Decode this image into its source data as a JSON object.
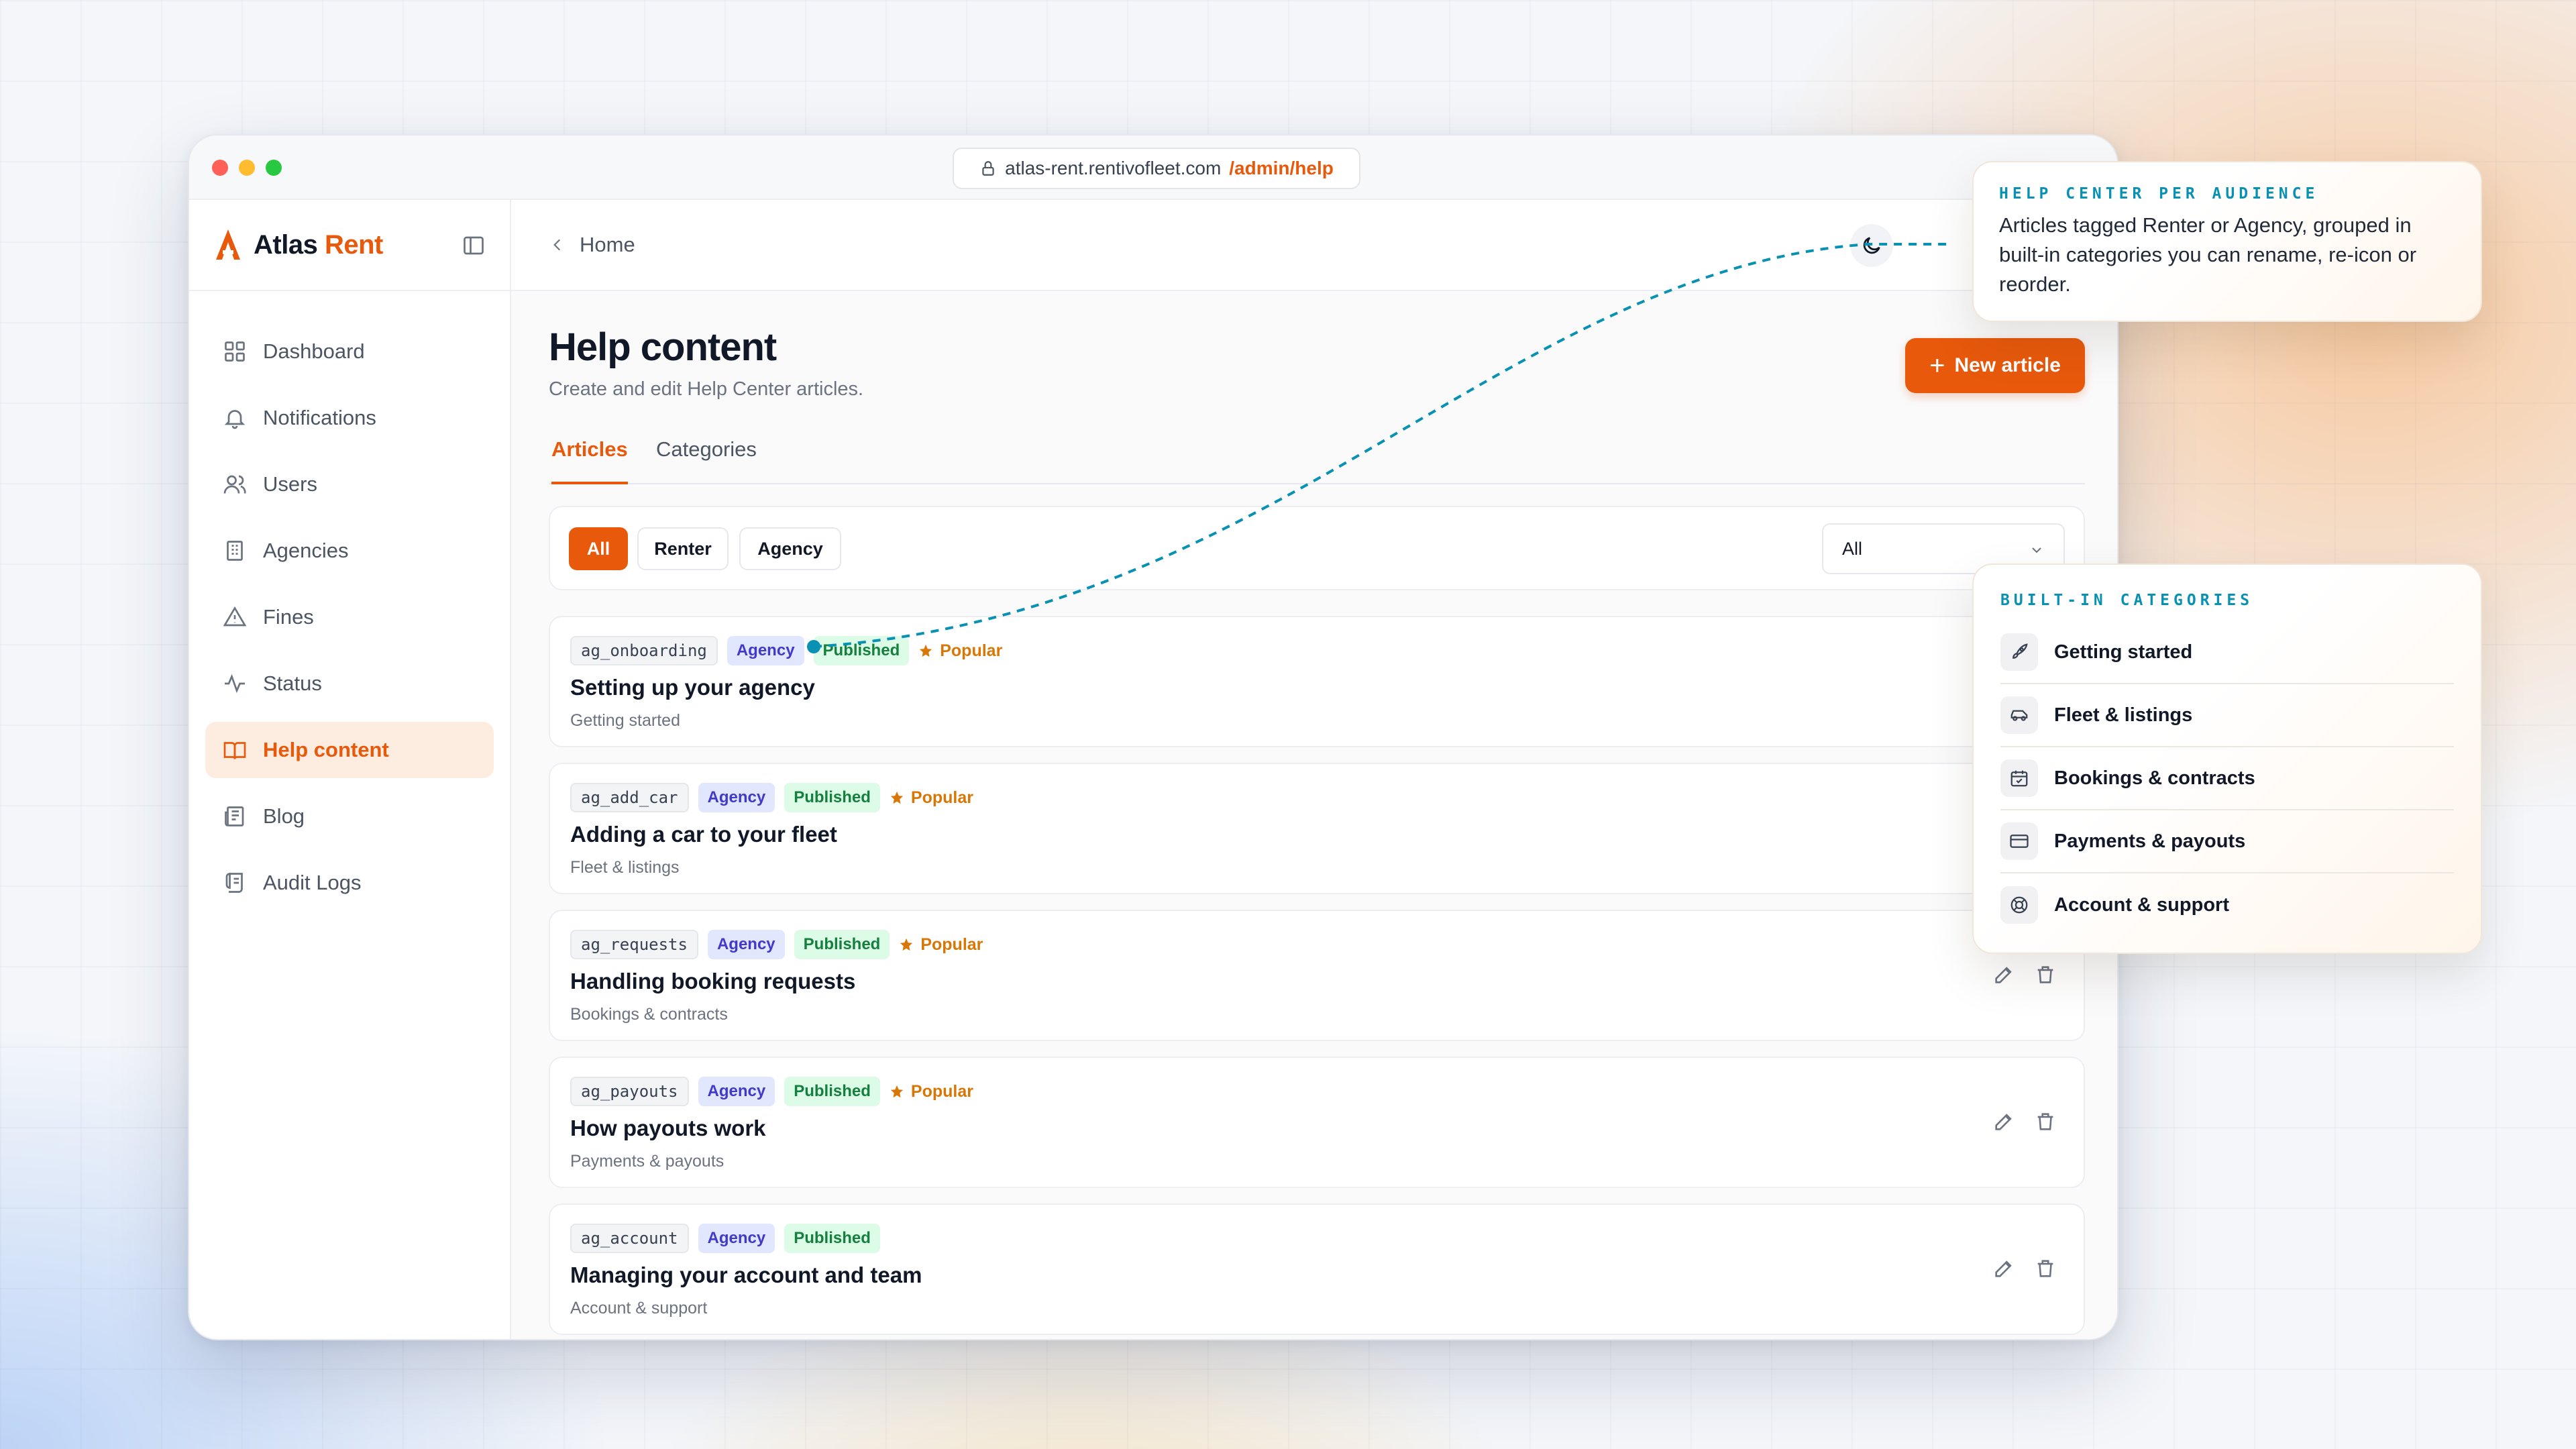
{
  "browser": {
    "url_host": "atlas-rent.rentivofleet.com",
    "url_path": "/admin/help"
  },
  "brand": {
    "name": "Atlas",
    "accent": "Rent"
  },
  "sidebar": {
    "items": [
      {
        "label": "Dashboard",
        "icon": "grid-icon"
      },
      {
        "label": "Notifications",
        "icon": "bell-icon"
      },
      {
        "label": "Users",
        "icon": "users-icon"
      },
      {
        "label": "Agencies",
        "icon": "building-icon"
      },
      {
        "label": "Fines",
        "icon": "warning-icon"
      },
      {
        "label": "Status",
        "icon": "activity-icon"
      },
      {
        "label": "Help content",
        "icon": "book-icon",
        "active": true
      },
      {
        "label": "Blog",
        "icon": "newspaper-icon"
      },
      {
        "label": "Audit Logs",
        "icon": "scroll-icon"
      }
    ]
  },
  "topbar": {
    "breadcrumb": "Home"
  },
  "page": {
    "title": "Help content",
    "subtitle": "Create and edit Help Center articles.",
    "new_button": "New article",
    "tabs": [
      "Articles",
      "Categories"
    ]
  },
  "filters": {
    "chips": [
      "All",
      "Renter",
      "Agency"
    ],
    "select_value": "All"
  },
  "articles": [
    {
      "slug": "ag_onboarding",
      "audience": "Agency",
      "status": "Published",
      "popular": "Popular",
      "title": "Setting up your agency",
      "category": "Getting started"
    },
    {
      "slug": "ag_add_car",
      "audience": "Agency",
      "status": "Published",
      "popular": "Popular",
      "title": "Adding a car to your fleet",
      "category": "Fleet & listings"
    },
    {
      "slug": "ag_requests",
      "audience": "Agency",
      "status": "Published",
      "popular": "Popular",
      "title": "Handling booking requests",
      "category": "Bookings & contracts"
    },
    {
      "slug": "ag_payouts",
      "audience": "Agency",
      "status": "Published",
      "popular": "Popular",
      "title": "How payouts work",
      "category": "Payments & payouts"
    },
    {
      "slug": "ag_account",
      "audience": "Agency",
      "status": "Published",
      "popular": "",
      "title": "Managing your account and team",
      "category": "Account & support"
    }
  ],
  "callout_audience": {
    "label": "HELP CENTER PER AUDIENCE",
    "text": "Articles tagged Renter or Agency, grouped in built-in categories you can rename, re-icon or reorder."
  },
  "callout_categories": {
    "label": "BUILT-IN CATEGORIES",
    "items": [
      {
        "label": "Getting started",
        "icon": "rocket-icon"
      },
      {
        "label": "Fleet & listings",
        "icon": "car-icon"
      },
      {
        "label": "Bookings & contracts",
        "icon": "calendar-icon"
      },
      {
        "label": "Payments & payouts",
        "icon": "credit-card-icon"
      },
      {
        "label": "Account & support",
        "icon": "lifebuoy-icon"
      }
    ]
  },
  "colors": {
    "accent": "#e8590c",
    "agency_tag": "#e0e7ff",
    "published_tag": "#dcfce7",
    "popular": "#d97706",
    "connector": "#0891b2"
  }
}
